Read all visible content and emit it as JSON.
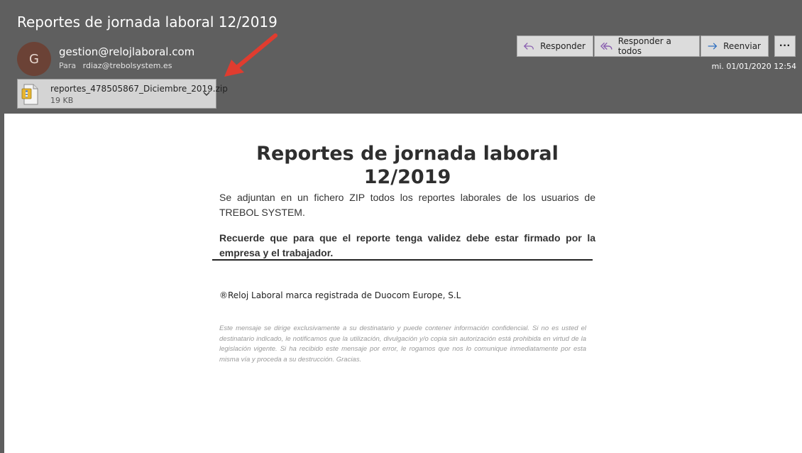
{
  "header": {
    "subject": "Reportes de jornada laboral 12/2019",
    "avatar_initial": "G",
    "sender": "gestion@relojlaboral.com",
    "to_label": "Para",
    "to_address": "rdiaz@trebolsystem.es",
    "date": "mi. 01/01/2020 12:54"
  },
  "attachment": {
    "filename": "reportes_478505867_Diciembre_2019.zip",
    "size": "19 KB",
    "icon": "zip-file-icon"
  },
  "actions": {
    "reply": "Responder",
    "reply_all": "Responder a todos",
    "forward": "Reenviar",
    "more": "···"
  },
  "annotation": {
    "arrow_color": "#e03c2f"
  },
  "message": {
    "title": "Reportes de jornada laboral 12/2019",
    "intro": "Se adjuntan en un fichero ZIP todos los reportes laborales de los usuarios de TREBOL SYSTEM.",
    "notice": "Recuerde que para que el reporte tenga validez debe estar firmado por la empresa y el trabajador.",
    "trademark": "®Reloj Laboral marca registrada de Duocom Europe, S.L",
    "disclaimer": "Este mensaje se dirige exclusivamente a su destinatario y puede contener información confidencial. Si no es usted el destinatario indicado, le notificamos que la utilización, divulgación y/o copia sin autorización está prohibida en virtud de la legislación vigente. Si ha recibido este mensaje por error, le rogamos que nos lo comunique inmediatamente por esta misma vía y proceda a su destrucción. Gracias."
  },
  "colors": {
    "header_bg": "#5f5f5f",
    "button_bg": "#dcdcdc",
    "reply_icon": "#8a5fb0",
    "forward_icon": "#2f6fc0"
  }
}
